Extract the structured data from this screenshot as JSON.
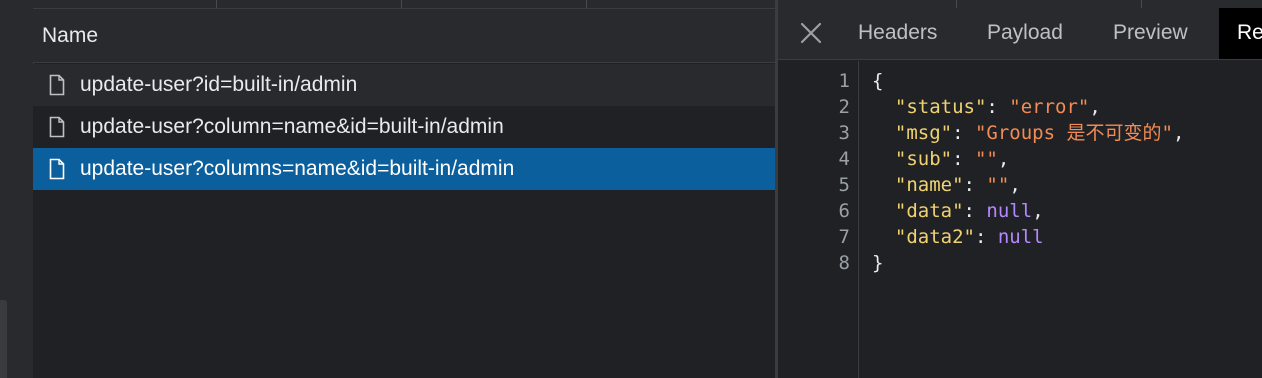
{
  "name_column": {
    "header": "Name"
  },
  "requests": [
    {
      "label": "update-user?id=built-in/admin",
      "icon": "file-icon",
      "selected": false
    },
    {
      "label": "update-user?column=name&id=built-in/admin",
      "icon": "file-icon",
      "selected": false
    },
    {
      "label": "update-user?columns=name&id=built-in/admin",
      "icon": "file-icon",
      "selected": true
    }
  ],
  "detail_tabs": {
    "close_icon": "close-icon",
    "tabs": [
      {
        "label": "Headers"
      },
      {
        "label": "Payload"
      },
      {
        "label": "Preview"
      },
      {
        "label": "Re",
        "active": true
      }
    ]
  },
  "response": {
    "line_numbers": [
      "1",
      "2",
      "3",
      "4",
      "5",
      "6",
      "7",
      "8"
    ],
    "lines": [
      {
        "open": "{"
      },
      {
        "key": "\"status\"",
        "value": "\"error\"",
        "value_type": "string",
        "comma": ","
      },
      {
        "key": "\"msg\"",
        "value": "\"Groups 是不可变的\"",
        "value_type": "string",
        "comma": ","
      },
      {
        "key": "\"sub\"",
        "value": "\"\"",
        "value_type": "string",
        "comma": ","
      },
      {
        "key": "\"name\"",
        "value": "\"\"",
        "value_type": "string",
        "comma": ","
      },
      {
        "key": "\"data\"",
        "value": "null",
        "value_type": "null",
        "comma": ","
      },
      {
        "key": "\"data2\"",
        "value": "null",
        "value_type": "null",
        "comma": ""
      },
      {
        "close": "}"
      }
    ]
  },
  "colors": {
    "background": "#202124",
    "selected_row": "#0b5f9d",
    "json_key": "#f0d370",
    "json_string": "#f28b54",
    "json_null": "#b388ff"
  }
}
